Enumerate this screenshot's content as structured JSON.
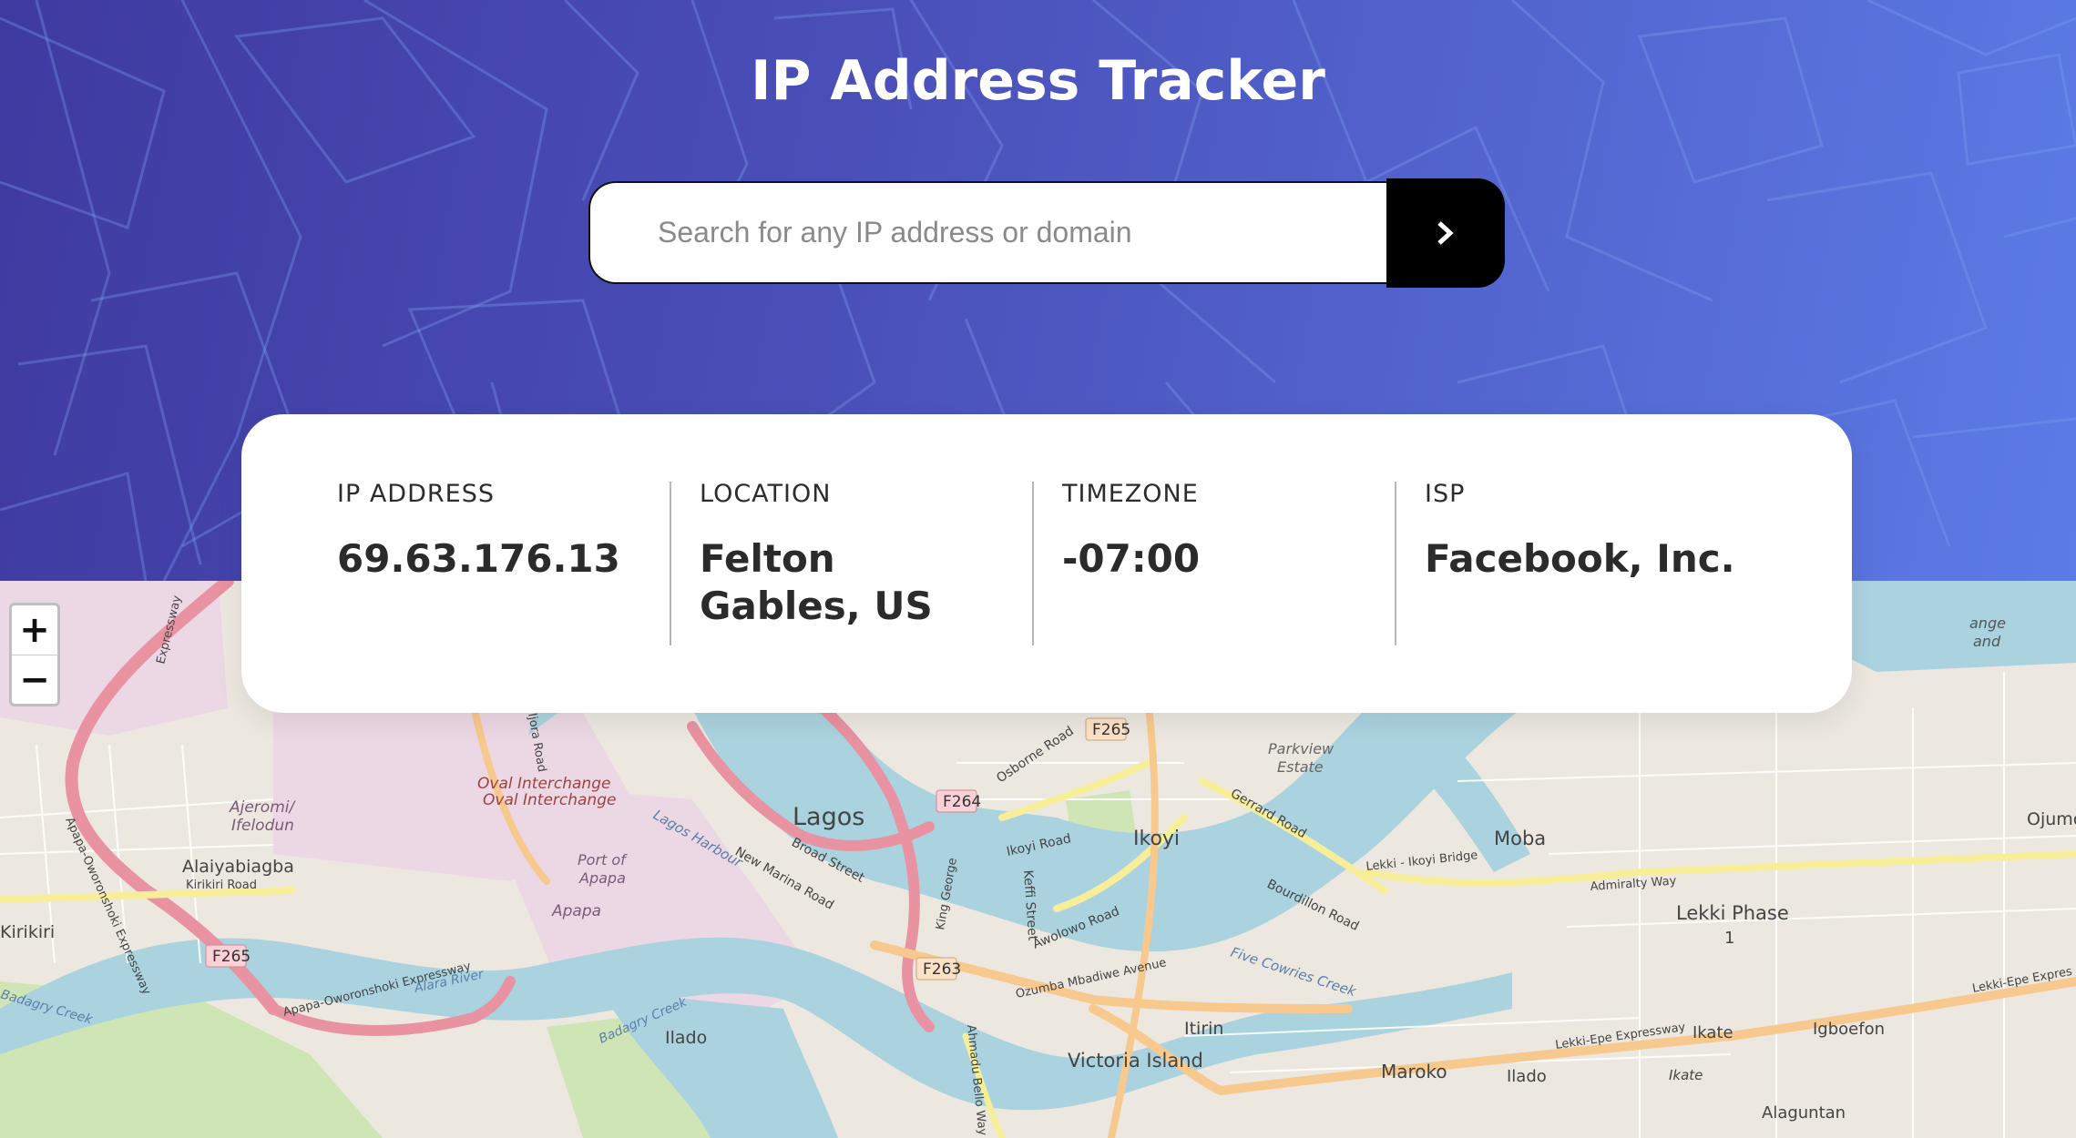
{
  "header": {
    "title": "IP Address Tracker"
  },
  "search": {
    "placeholder": "Search for any IP address or domain",
    "value": "",
    "button_icon": "chevron-right-icon"
  },
  "info": {
    "ip": {
      "label": "IP ADDRESS",
      "value": "69.63.176.13"
    },
    "location": {
      "label": "LOCATION",
      "value": "Felton Gables, US"
    },
    "timezone": {
      "label": "TIMEZONE",
      "value": "-07:00"
    },
    "isp": {
      "label": "ISP",
      "value": "Facebook, Inc."
    }
  },
  "map": {
    "zoom_in_label": "+",
    "zoom_out_label": "−",
    "places": {
      "lagos": "Lagos",
      "ikoyi": "Ikoyi",
      "moba": "Moba",
      "lekki_phase": "Lekki Phase",
      "lekki_phase_num": "1",
      "ojumo": "Ojumo",
      "alaiyabiagba": "Alaiyabiagba",
      "kirikiri_road": "Kirikiri Road",
      "kirikiri": "Kirikiri",
      "ajeromi": "Ajeromi/",
      "ifelodun": "Ifelodun",
      "oval_1": "Oval Interchange",
      "oval_2": "Oval Interchange",
      "port_of": "Port of",
      "apapa_port": "Apapa",
      "apapa": "Apapa",
      "ilado_left": "Ilado",
      "itirin": "Itirin",
      "victoria_island": "Victoria Island",
      "maroko": "Maroko",
      "ilado_right": "Ilado",
      "ikate": "Ikate",
      "ikate_small": "Ikate",
      "igboefon": "Igboefon",
      "alaguntan": "Alaguntan",
      "parkview_1": "Parkview",
      "parkview_2": "Estate",
      "lagos_harbour": "Lagos Harbour",
      "broad_street": "Broad Street",
      "new_marina": "New Marina Road",
      "ikoyi_road": "Ikoyi Road",
      "kefli_street": "Keffi Street",
      "awolowo_road": "Awolowo Road",
      "bourdillon_road": "Bourdillon Road",
      "gerrard_road": "Gerrard Road",
      "osborne_road": "Osborne Road",
      "lekki_ikoyi_bridge": "Lekki - Ikoyi Bridge",
      "admiralty_way": "Admiralty Way",
      "five_cowries": "Five Cowries Creek",
      "ozumba": "Ozumba Mbadiwe Avenue",
      "lekki_epe_1": "Lekki-Epe Expressway",
      "lekki_epe_2": "Lekki-Epe Expres",
      "apapa_oworonshoki_1": "Apapa-Oworonshoki Expressway",
      "apapa_oworonshoki_2": "Apapa-Oworonshoki Expressway",
      "alara_river": "Alara River",
      "badagry_creek_1": "Badagry Creek",
      "badagry_creek_2": "Badagry Creek",
      "ahmadu_bello": "Ahmadu Bello Way",
      "ilupo_road": "Ijora Road",
      "king_road": "King George",
      "expressway_top": "Expressway",
      "f265_top": "F265",
      "f264": "F264",
      "f263": "F263",
      "f265_left": "F265",
      "ange_1": "ange",
      "ange_2": "and"
    }
  }
}
